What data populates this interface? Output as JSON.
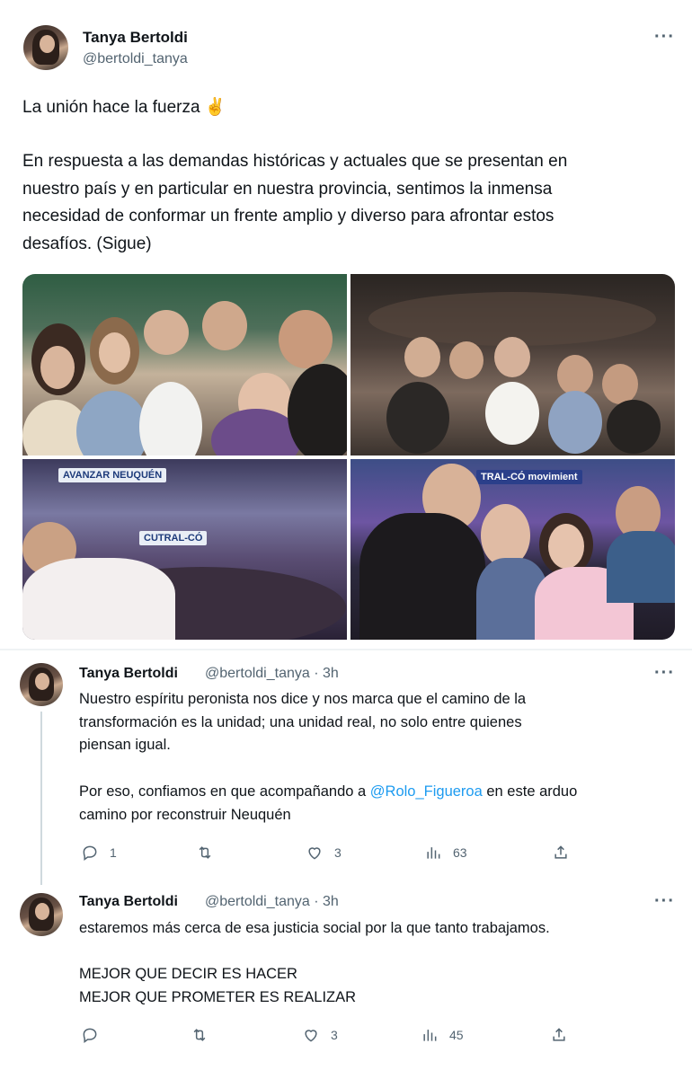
{
  "main_tweet": {
    "display_name": "Tanya Bertoldi",
    "handle": "@bertoldi_tanya",
    "more": "···",
    "text_line1": "La unión hace la fuerza ✌️",
    "text_body": "En respuesta a las demandas históricas y actuales que se presentan en\nnuestro país y en particular en nuestra provincia, sentimos la inmensa\nnecesidad de conformar un frente amplio y diverso para afrontar estos\ndesafíos. (Sigue)",
    "photo_signs": [
      "AVANZAR NEUQUÉN",
      "CUTRAL-CÓ",
      "TRAL-CÓ movimient"
    ]
  },
  "replies": [
    {
      "display_name": "Tanya Bertoldi",
      "handle_time": "@bertoldi_tanya · 3h",
      "more": "···",
      "text_a": "Nuestro espíritu peronista nos dice y nos marca que el camino de la\ntransformación es la unidad; una unidad real, no solo entre quienes\npiensan igual.",
      "text_b_prefix": "Por eso, confiamos en que acompañando a ",
      "mention": "@Rolo_Figueroa",
      "text_b_suffix": " en este arduo",
      "text_b_line2": "camino por reconstruir Neuquén",
      "replies_count": "1",
      "retweets_count": "",
      "likes_count": "3",
      "views_count": "63"
    },
    {
      "display_name": "Tanya Bertoldi",
      "handle_time": "@bertoldi_tanya · 3h",
      "more": "···",
      "text": "estaremos más cerca de esa justicia social por la que tanto trabajamos.\n\nMEJOR QUE DECIR ES HACER\nMEJOR QUE PROMETER ES REALIZAR",
      "replies_count": "",
      "retweets_count": "",
      "likes_count": "3",
      "views_count": "45"
    }
  ],
  "icons": [
    "reply-icon",
    "retweet-icon",
    "like-icon",
    "views-icon",
    "share-icon",
    "more-icon"
  ],
  "colors": {
    "text": "#0f1419",
    "secondary": "#536471",
    "link": "#1d9bf0",
    "line": "#cfd9de"
  }
}
